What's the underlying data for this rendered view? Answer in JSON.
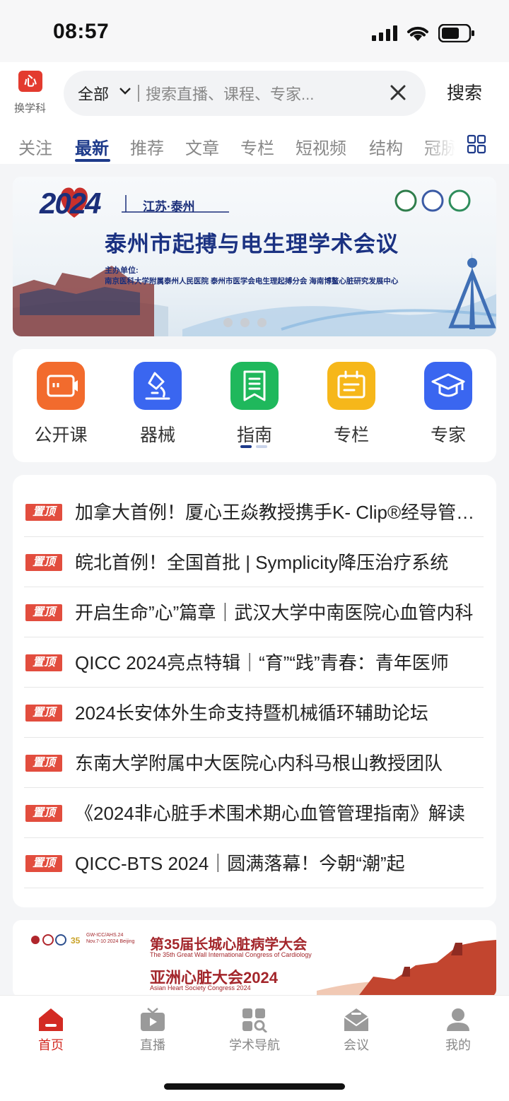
{
  "status_bar": {
    "time": "08:57"
  },
  "header": {
    "logo_text": "心",
    "switch_label": "换学科",
    "search": {
      "scope": "全部",
      "placeholder": "搜索直播、课程、专家..."
    },
    "search_button": "搜索"
  },
  "tabs": [
    {
      "label": "关注"
    },
    {
      "label": "最新",
      "active": true
    },
    {
      "label": "推荐"
    },
    {
      "label": "文章"
    },
    {
      "label": "专栏"
    },
    {
      "label": "短视频"
    },
    {
      "label": "结构"
    },
    {
      "label": "冠脉"
    }
  ],
  "banner": {
    "year": "2024",
    "location": "江苏·泰州",
    "title": "泰州市起搏与电生理学术会议",
    "organizer_label": "主办单位:",
    "organizers": "南京医科大学附属泰州人民医院   泰州市医学会电生理起搏分会   海南博鳌心脏研究发展中心",
    "pages": 3,
    "active_page": 1
  },
  "quick_links": [
    {
      "label": "公开课",
      "icon": "video-camera-icon",
      "color": "#f26b2d"
    },
    {
      "label": "器械",
      "icon": "microscope-icon",
      "color": "#3a66f0"
    },
    {
      "label": "指南",
      "icon": "book-icon",
      "color": "#1fb85c"
    },
    {
      "label": "专栏",
      "icon": "column-icon",
      "color": "#f6b71a"
    },
    {
      "label": "专家",
      "icon": "graduation-cap-icon",
      "color": "#3a66f0"
    }
  ],
  "pinned_badge": "置顶",
  "news": [
    "加拿大首例！厦心王焱教授携手K- Clip®经导管三尖瓣修复",
    "皖北首例！全国首批 | Symplicity降压治疗系统",
    "开启生命”心”篇章｜武汉大学中南医院心血管内科",
    "QICC 2024亮点特辑｜“育”“践”青春：青年医师",
    "2024长安体外生命支持暨机械循环辅助论坛",
    "东南大学附属中大医院心内科马根山教授团队",
    "《2024非心脏手术围术期心血管管理指南》解读",
    "QICC-BTS 2024｜圆满落幕！今朝“潮”起"
  ],
  "ad": {
    "tag1": "GW-ICC/AHS.24",
    "tag2": "Nov.7-10 2024 Beijing",
    "title1": "第35届长城心脏病学大会",
    "subtitle1": "The 35th Great Wall International Congress of Cardiology",
    "title2": "亚洲心脏大会2024",
    "subtitle2": "Asian Heart Society Congress 2024"
  },
  "bottom_nav": [
    {
      "label": "首页",
      "icon": "home-icon",
      "active": true
    },
    {
      "label": "直播",
      "icon": "tv-icon"
    },
    {
      "label": "学术导航",
      "icon": "navigation-icon"
    },
    {
      "label": "会议",
      "icon": "meeting-icon"
    },
    {
      "label": "我的",
      "icon": "user-icon"
    }
  ],
  "colors": {
    "accent": "#1d3a8a",
    "brand_red": "#e33b2f",
    "badge_red": "#e24d3e"
  }
}
